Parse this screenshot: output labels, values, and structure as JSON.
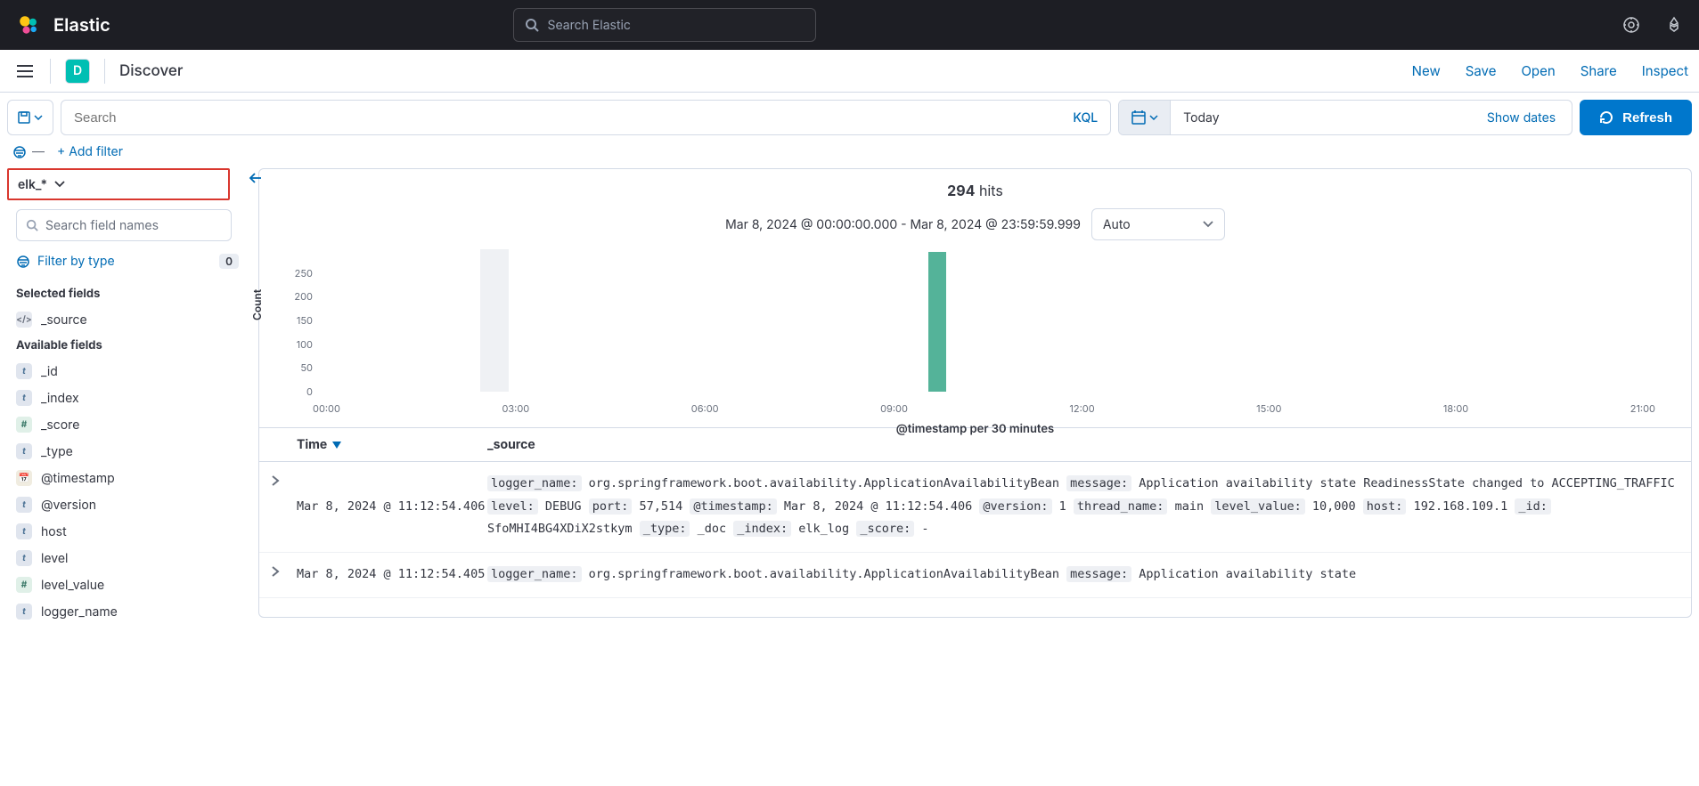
{
  "brand": "Elastic",
  "global_search_placeholder": "Search Elastic",
  "page": {
    "title": "Discover",
    "space_letter": "D"
  },
  "header_actions": [
    "New",
    "Save",
    "Open",
    "Share",
    "Inspect"
  ],
  "query": {
    "search_placeholder": "Search",
    "language": "KQL",
    "date_label": "Today",
    "show_dates": "Show dates",
    "refresh": "Refresh"
  },
  "filters": {
    "add_filter": "+ Add filter"
  },
  "sidebar": {
    "index_pattern": "elk_*",
    "field_search_placeholder": "Search field names",
    "filter_by_type": "Filter by type",
    "filter_count": "0",
    "selected_label": "Selected fields",
    "selected": [
      {
        "tok": "src",
        "name": "_source"
      }
    ],
    "available_label": "Available fields",
    "available": [
      {
        "tok": "t",
        "name": "_id"
      },
      {
        "tok": "t",
        "name": "_index"
      },
      {
        "tok": "n",
        "name": "_score"
      },
      {
        "tok": "t",
        "name": "_type"
      },
      {
        "tok": "d",
        "name": "@timestamp"
      },
      {
        "tok": "t",
        "name": "@version"
      },
      {
        "tok": "t",
        "name": "host"
      },
      {
        "tok": "t",
        "name": "level"
      },
      {
        "tok": "n",
        "name": "level_value"
      },
      {
        "tok": "t",
        "name": "logger_name"
      }
    ]
  },
  "results": {
    "hits_count": "294",
    "hits_label": "hits",
    "time_range": "Mar 8, 2024 @ 00:00:00.000 - Mar 8, 2024 @ 23:59:59.999",
    "interval": "Auto",
    "xlabel": "@timestamp per 30 minutes",
    "ylabel": "Count",
    "columns": {
      "time": "Time",
      "source": "_source"
    },
    "docs": [
      {
        "time": "Mar 8, 2024 @ 11:12:54.406",
        "pairs": [
          {
            "k": "logger_name:",
            "v": "org.springframework.boot.availability.ApplicationAvailabilityBean"
          },
          {
            "k": "message:",
            "v": "Application availability state ReadinessState changed to ACCEPTING_TRAFFIC"
          },
          {
            "k": "level:",
            "v": "DEBUG"
          },
          {
            "k": "port:",
            "v": "57,514"
          },
          {
            "k": "@timestamp:",
            "v": "Mar 8, 2024 @ 11:12:54.406"
          },
          {
            "k": "@version:",
            "v": "1"
          },
          {
            "k": "thread_name:",
            "v": "main"
          },
          {
            "k": "level_value:",
            "v": "10,000"
          },
          {
            "k": "host:",
            "v": "192.168.109.1"
          },
          {
            "k": "_id:",
            "v": "SfoMHI4BG4XDiX2stkym"
          },
          {
            "k": "_type:",
            "v": "_doc"
          },
          {
            "k": "_index:",
            "v": "elk_log"
          },
          {
            "k": "_score:",
            "v": "-"
          }
        ]
      },
      {
        "time": "Mar 8, 2024 @ 11:12:54.405",
        "pairs": [
          {
            "k": "logger_name:",
            "v": "org.springframework.boot.availability.ApplicationAvailabilityBean"
          },
          {
            "k": "message:",
            "v": "Application availability state"
          }
        ]
      }
    ]
  },
  "chart_data": {
    "type": "bar",
    "title": "",
    "xlabel": "@timestamp per 30 minutes",
    "ylabel": "Count",
    "ylim": [
      0,
      300
    ],
    "y_ticks": [
      0,
      50,
      100,
      150,
      200,
      250
    ],
    "x_ticks": [
      "00:00",
      "03:00",
      "06:00",
      "09:00",
      "12:00",
      "15:00",
      "18:00",
      "21:00"
    ],
    "series": [
      {
        "name": "Count",
        "x": [
          "11:00"
        ],
        "values": [
          294
        ]
      }
    ],
    "brush_range": [
      "03:00",
      "03:30"
    ]
  }
}
